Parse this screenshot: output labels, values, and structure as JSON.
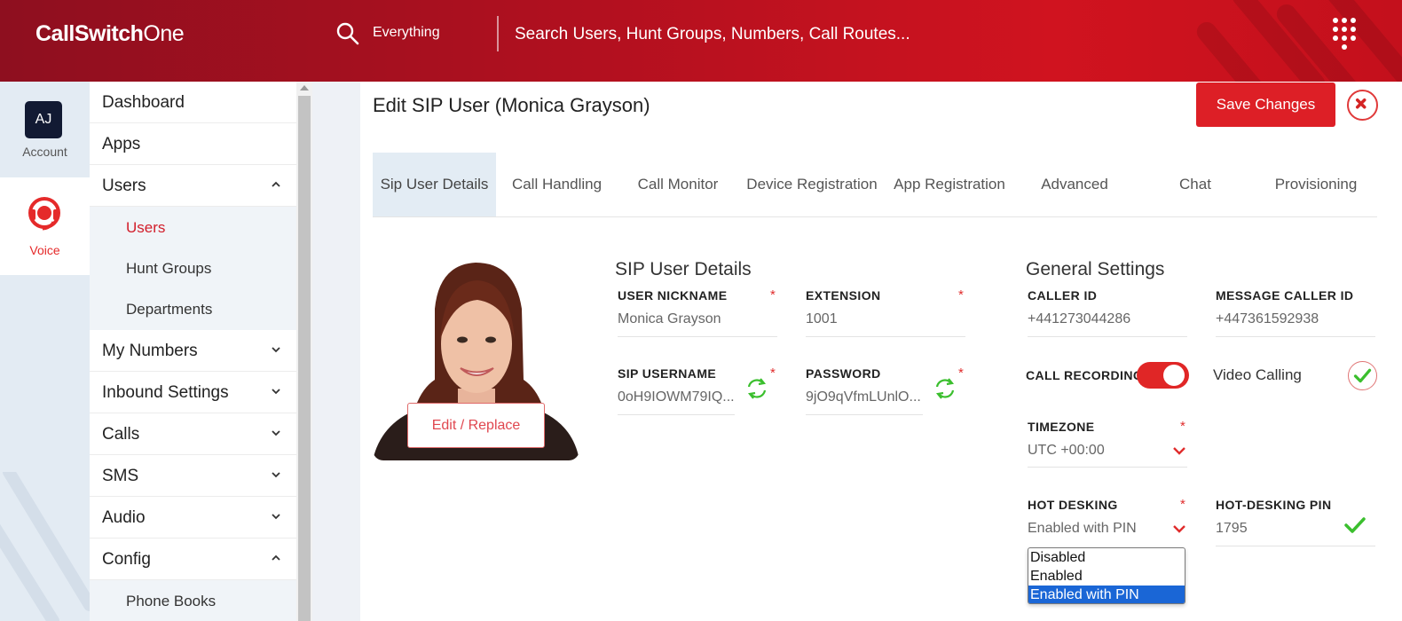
{
  "app": {
    "brand_bold": "CallSwitch",
    "brand_thin": "One"
  },
  "header": {
    "search_scope": "Everything",
    "search_placeholder": "Search Users, Hunt Groups, Numbers, Call Routes..."
  },
  "rail": {
    "account": {
      "initials": "AJ",
      "label": "Account"
    },
    "voice": {
      "label": "Voice"
    }
  },
  "nav": {
    "items": [
      {
        "label": "Dashboard"
      },
      {
        "label": "Apps"
      },
      {
        "label": "Users",
        "expanded": true,
        "children": [
          {
            "label": "Users",
            "active": true
          },
          {
            "label": "Hunt Groups"
          },
          {
            "label": "Departments"
          }
        ]
      },
      {
        "label": "My Numbers"
      },
      {
        "label": "Inbound Settings"
      },
      {
        "label": "Calls"
      },
      {
        "label": "SMS"
      },
      {
        "label": "Audio"
      },
      {
        "label": "Config",
        "expanded": true,
        "children": [
          {
            "label": "Phone Books"
          }
        ]
      }
    ]
  },
  "page": {
    "title": "Edit SIP User (Monica Grayson)",
    "save_label": "Save Changes",
    "edit_photo_label": "Edit / Replace"
  },
  "tabs": [
    {
      "label": "Sip User Details",
      "active": true
    },
    {
      "label": "Call Handling"
    },
    {
      "label": "Call Monitor"
    },
    {
      "label": "Device Registration"
    },
    {
      "label": "App Registration"
    },
    {
      "label": "Advanced"
    },
    {
      "label": "Chat"
    },
    {
      "label": "Provisioning"
    }
  ],
  "sip_details": {
    "title": "SIP User Details",
    "nickname": {
      "label": "USER NICKNAME",
      "value": "Monica Grayson",
      "required": "*"
    },
    "extension": {
      "label": "EXTENSION",
      "value": "1001",
      "required": "*"
    },
    "sip_username": {
      "label": "SIP USERNAME",
      "value": "0oH9IOWM79IQ...",
      "required": "*"
    },
    "password": {
      "label": "PASSWORD",
      "value": "9jO9qVfmLUnlO...",
      "required": "*"
    }
  },
  "general": {
    "title": "General Settings",
    "caller_id": {
      "label": "CALLER ID",
      "value": "+441273044286"
    },
    "message_caller_id": {
      "label": "MESSAGE CALLER ID",
      "value": "+447361592938"
    },
    "call_recording": {
      "label": "CALL RECORDING",
      "on": true
    },
    "video_calling": {
      "label": "Video Calling",
      "checked": true
    },
    "timezone": {
      "label": "TIMEZONE",
      "value": "UTC +00:00",
      "required": "*"
    },
    "hot_desking": {
      "label": "HOT DESKING",
      "value": "Enabled with PIN",
      "required": "*",
      "options": [
        {
          "label": "Disabled"
        },
        {
          "label": "Enabled"
        },
        {
          "label": "Enabled with PIN",
          "selected": true
        }
      ]
    },
    "hot_desking_pin": {
      "label": "HOT-DESKING PIN",
      "value": "1795"
    }
  },
  "colors": {
    "brand_red": "#dd1f26",
    "accent_green": "#3bbf2e",
    "select_blue": "#1a66d6"
  },
  "icons": {
    "search": "search-icon",
    "dialpad": "dialpad-icon",
    "voice": "headset-icon",
    "close": "close-icon",
    "refresh": "refresh-icon",
    "chevron": "chevron-down-icon",
    "check": "check-icon"
  }
}
